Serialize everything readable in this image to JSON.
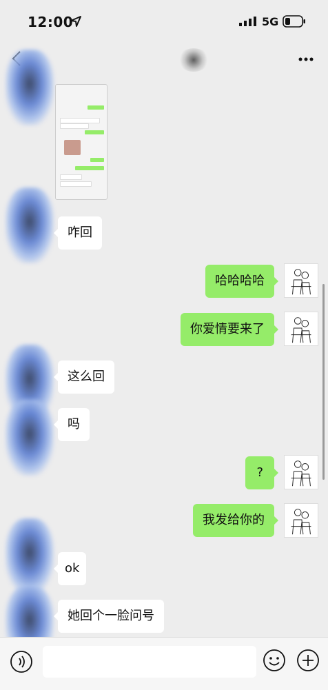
{
  "status_bar": {
    "time": "12:00",
    "network": "5G"
  },
  "messages": [
    {
      "side": "left",
      "text": "咋回"
    },
    {
      "side": "right",
      "text": "哈哈哈哈"
    },
    {
      "side": "right",
      "text": "你爱情要来了"
    },
    {
      "side": "left",
      "text": "这么回"
    },
    {
      "side": "left",
      "text": "吗"
    },
    {
      "side": "right",
      "text": "?"
    },
    {
      "side": "right",
      "text": "我发给你的"
    },
    {
      "side": "left",
      "text": "ok"
    },
    {
      "side": "left",
      "text": "她回个一脸问号"
    }
  ],
  "colors": {
    "accent_green": "#95ec69",
    "background": "#ededed",
    "bubble_white": "#ffffff"
  },
  "icons": [
    "location-arrow-icon",
    "signal-icon",
    "battery-icon",
    "back-icon",
    "more-icon",
    "voice-icon",
    "emoji-icon",
    "plus-icon"
  ]
}
